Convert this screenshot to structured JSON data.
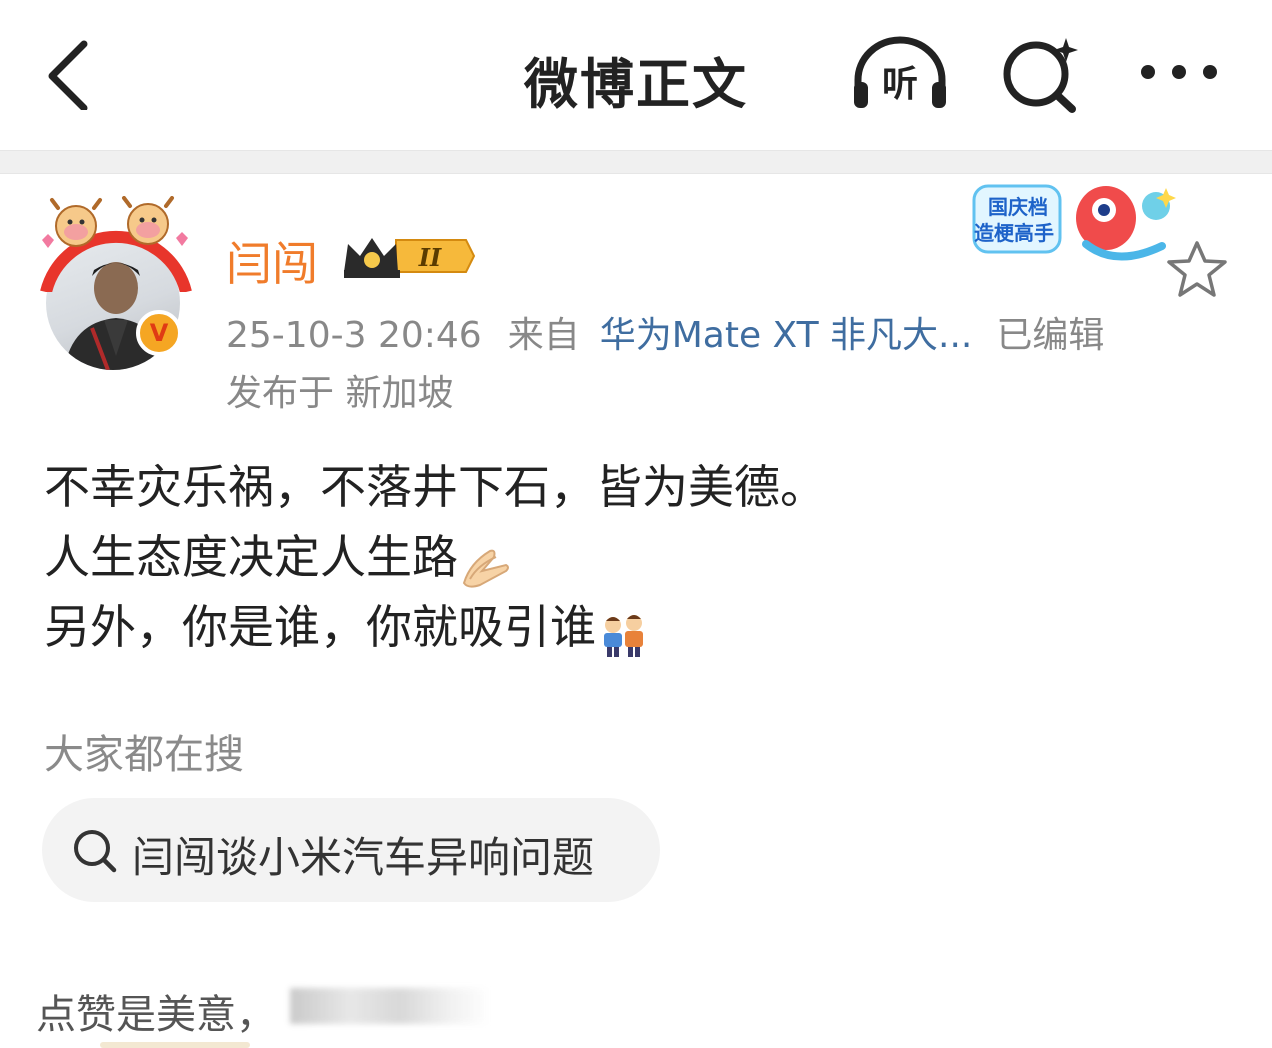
{
  "header": {
    "title": "微博正文",
    "listen_label": "听"
  },
  "post": {
    "username": "闫闯",
    "vip_level": "II",
    "timestamp": "25-10-3 20:46",
    "from_label": "来自",
    "source": "华为Mate XT 非凡大...",
    "edited_label": "已编辑",
    "location": "发布于 新加坡",
    "verified_mark": "V",
    "sticker_text": [
      "国庆档",
      "造梗高手"
    ],
    "lines": [
      "不幸灾乐祸，不落井下石，皆为美德。",
      "人生态度决定人生路",
      "另外，你是谁，你就吸引谁"
    ],
    "emojis": [
      "folded-hands",
      "two-boys"
    ]
  },
  "search": {
    "section_title": "大家都在搜",
    "chip_text": "闫闯谈小米汽车异响问题"
  },
  "footer": {
    "text": "点赞是美意，"
  },
  "colors": {
    "username": "#f07c2b",
    "link": "#3f6da0",
    "meta": "#888888",
    "divider": "#f0f0f0"
  }
}
